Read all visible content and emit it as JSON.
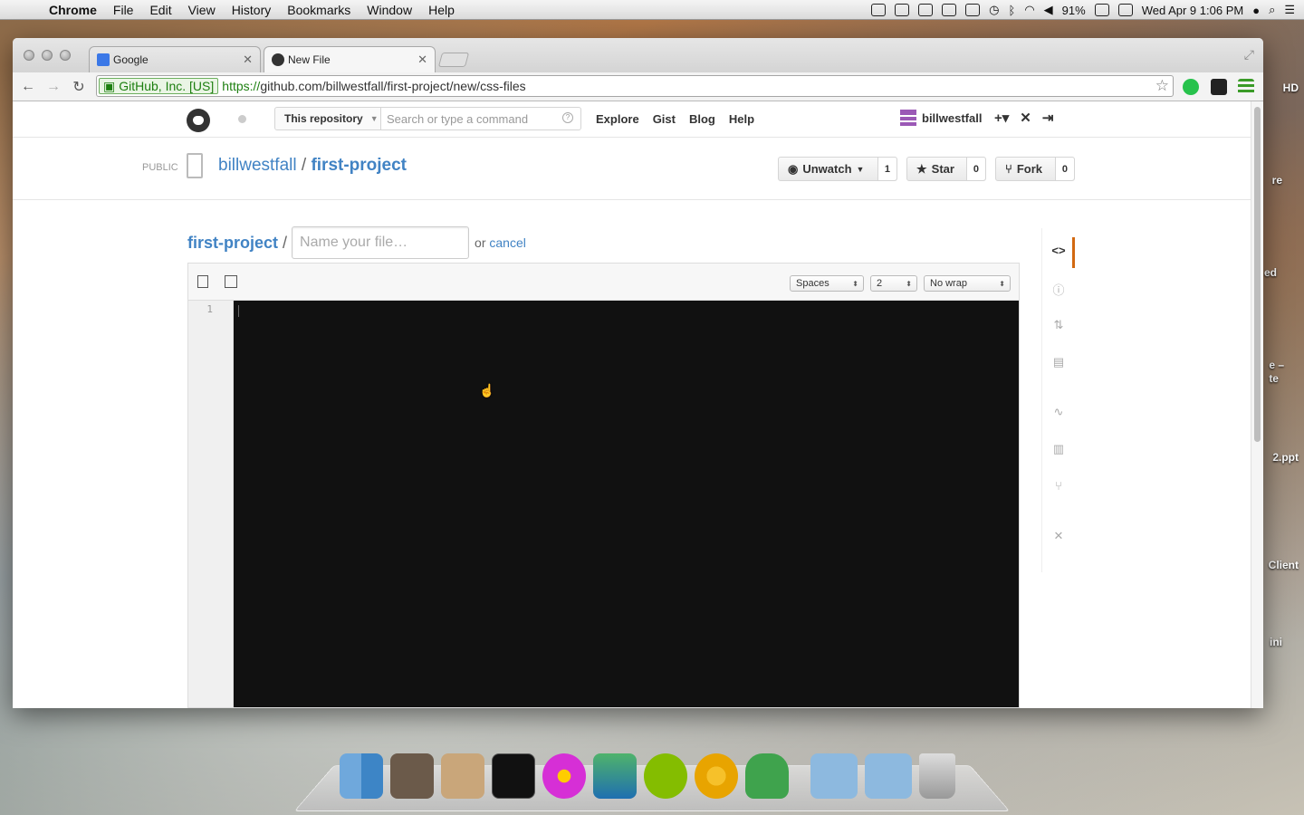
{
  "menubar": {
    "app_name": "Chrome",
    "items": [
      "File",
      "Edit",
      "View",
      "History",
      "Bookmarks",
      "Window",
      "Help"
    ],
    "battery": "91%",
    "datetime": "Wed Apr 9  1:06 PM"
  },
  "desktop": {
    "labels": [
      "HD",
      "re",
      "ed",
      "e –\nte",
      "2.ppt",
      "Client",
      "ini"
    ]
  },
  "browser": {
    "tabs": [
      {
        "title": "Google",
        "active": false
      },
      {
        "title": "New File",
        "active": true
      }
    ],
    "ev_cert": "GitHub, Inc. [US]",
    "url_scheme": "https://",
    "url_rest": "github.com/billwestfall/first-project/new/css-files"
  },
  "github": {
    "scope_label": "This repository",
    "search_placeholder": "Search or type a command",
    "nav": [
      "Explore",
      "Gist",
      "Blog",
      "Help"
    ],
    "username": "billwestfall",
    "public_label": "PUBLIC",
    "owner": "billwestfall",
    "repo_sep": " / ",
    "repo": "first-project",
    "watch_label": "Unwatch",
    "watch_count": "1",
    "star_label": "Star",
    "star_count": "0",
    "fork_label": "Fork",
    "fork_count": "0",
    "breadcrumb": "first-project",
    "breadcrumb_sep": "/",
    "filename_placeholder": "Name your file…",
    "or_text": "or ",
    "cancel_label": "cancel",
    "indent_mode": "Spaces",
    "indent_size": "2",
    "wrap_mode": "No wrap",
    "line_number": "1"
  },
  "colors": {
    "link": "#4183c4",
    "active_nav_bar": "#d26911",
    "editor_bg": "#111111"
  }
}
